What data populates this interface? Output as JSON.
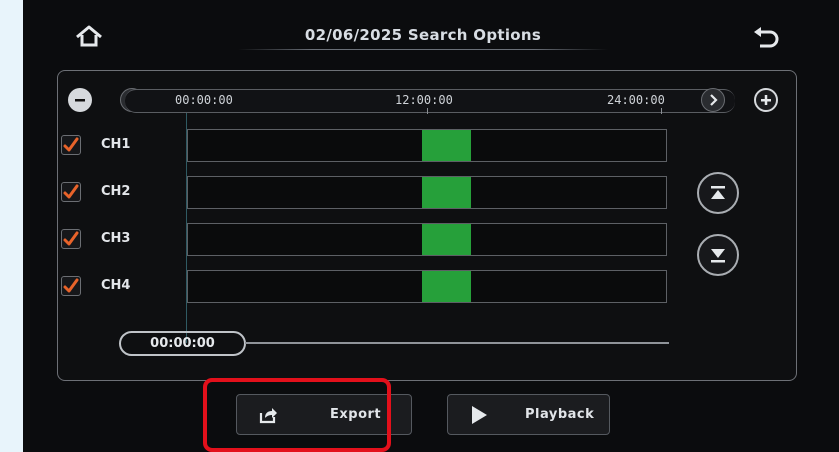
{
  "header": {
    "home_icon": "home-icon",
    "title": "02/06/2025  Search Options",
    "back_icon": "back-arrow-icon"
  },
  "timeline": {
    "zoom_out_icon": "minus-icon",
    "zoom_in_icon": "plus-icon",
    "prev_icon": "chevron-left-icon",
    "next_icon": "chevron-right-icon",
    "ticks": [
      "00:00:00",
      "12:00:00",
      "24:00:00"
    ]
  },
  "channels": [
    {
      "label": "CH1",
      "checked": true,
      "recording": {
        "start": "12:00",
        "end": "14:30"
      }
    },
    {
      "label": "CH2",
      "checked": true,
      "recording": {
        "start": "12:00",
        "end": "14:30"
      }
    },
    {
      "label": "CH3",
      "checked": true,
      "recording": {
        "start": "12:00",
        "end": "14:30"
      }
    },
    {
      "label": "CH4",
      "checked": true,
      "recording": {
        "start": "12:00",
        "end": "14:30"
      }
    }
  ],
  "scroll": {
    "up_icon": "scroll-to-top-icon",
    "down_icon": "scroll-to-bottom-icon"
  },
  "position": {
    "current_time": "00:00:00"
  },
  "actions": {
    "export_label": "Export",
    "export_icon": "export-share-icon",
    "playback_label": "Playback",
    "playback_icon": "play-icon"
  },
  "colors": {
    "recording": "#26a03a",
    "check": "#e8632a",
    "highlight": "#e3101b"
  }
}
